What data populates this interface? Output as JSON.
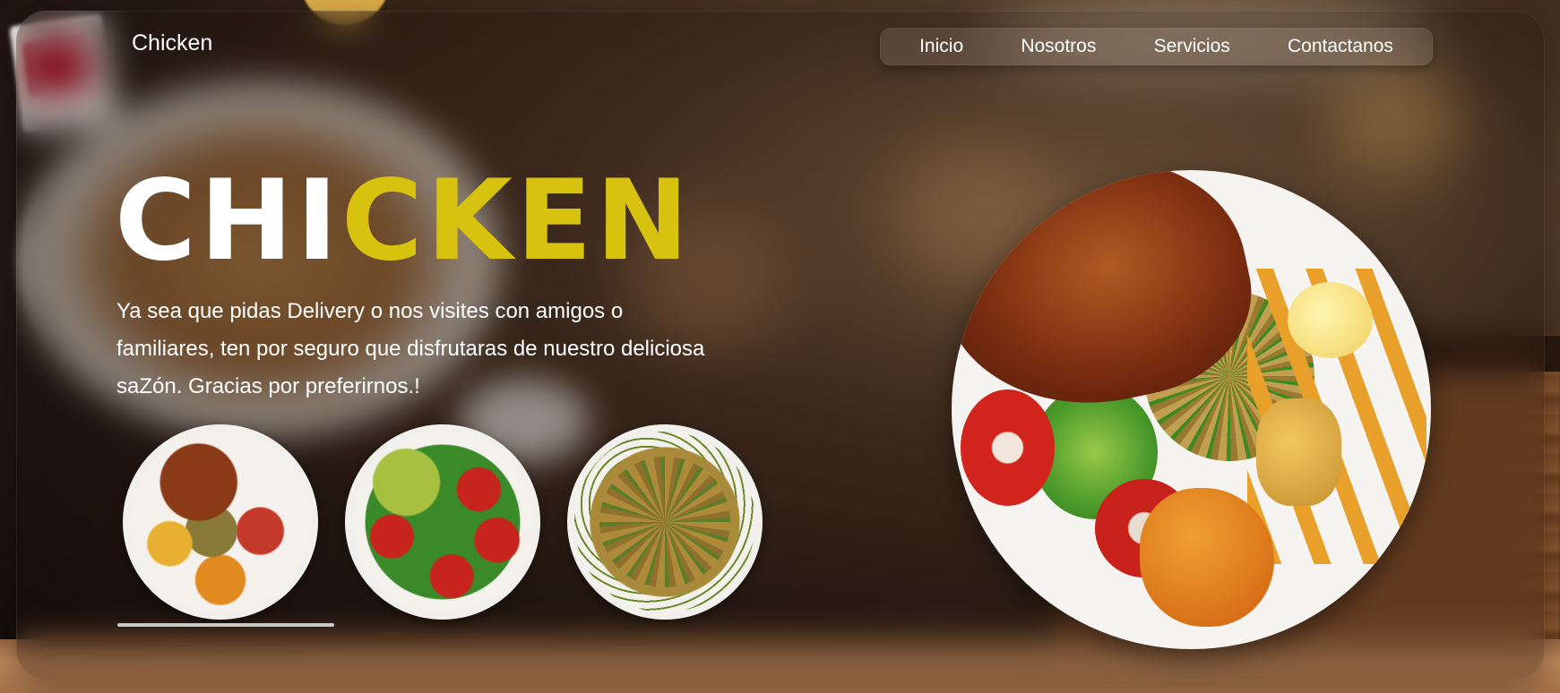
{
  "header": {
    "brand": "Chicken",
    "nav": [
      {
        "label": "Inicio"
      },
      {
        "label": "Nosotros"
      },
      {
        "label": "Servicios"
      },
      {
        "label": "Contactanos"
      }
    ]
  },
  "hero": {
    "title_part1": "CHI",
    "title_part2": "CKEN",
    "description": "Ya sea que pidas Delivery o nos visites con amigos o familiares, ten por seguro que disfrutaras de nuestro deliciosa saZón. Gracias por preferirnos.!"
  },
  "colors": {
    "accent": "#d7c20f",
    "text": "#ffffff"
  }
}
